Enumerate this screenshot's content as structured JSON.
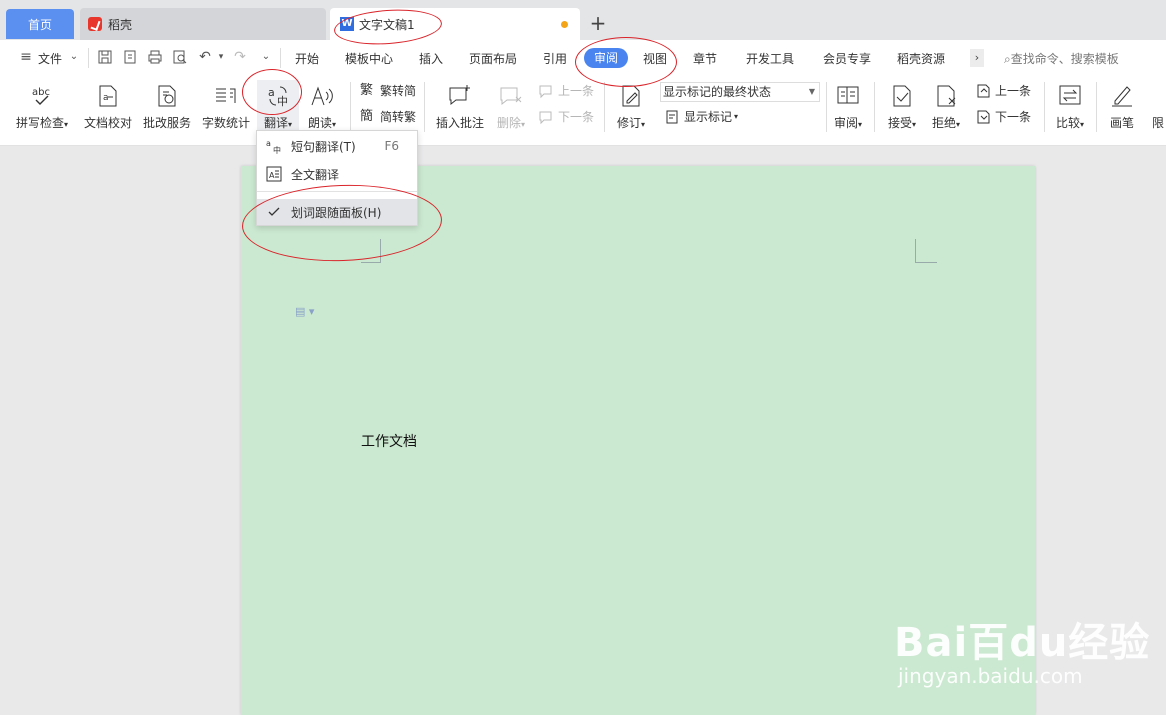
{
  "tabs": {
    "home": "首页",
    "daoke": "稻壳",
    "doc": "文字文稿1",
    "new_tab": "+"
  },
  "menu_bar": {
    "file": "文件",
    "items": [
      "开始",
      "模板中心",
      "插入",
      "页面布局",
      "引用",
      "审阅",
      "视图",
      "章节",
      "开发工具",
      "会员专享",
      "稻壳资源"
    ],
    "active": "审阅",
    "more": "›",
    "search_placeholder": "查找命令、搜索模板"
  },
  "ribbon": {
    "spellcheck": "拼写检查",
    "doc_proof": "文档校对",
    "revise_service": "批改服务",
    "word_count": "字数统计",
    "translate": "翻译",
    "read_aloud": "朗读",
    "trad_to_simp": "繁转简",
    "simp_to_trad": "简转繁",
    "insert_comment": "插入批注",
    "delete": "删除",
    "prev": "上一条",
    "next": "下一条",
    "track_changes": "修订",
    "markup_state": "显示标记的最终状态",
    "show_markup": "显示标记",
    "review": "审阅",
    "accept": "接受",
    "reject": "拒绝",
    "prev_change": "上一条",
    "next_change": "下一条",
    "compare": "比较",
    "pen": "画笔",
    "restrict": "限"
  },
  "translate_menu": {
    "sentence": "短句翻译(T)",
    "sentence_key": "F6",
    "full": "全文翻译",
    "follow_panel": "划词跟随面板(H)"
  },
  "document": {
    "text": "工作文档"
  },
  "watermark": {
    "main": "Bai百du经验",
    "sub": "jingyan.baidu.com"
  },
  "colors": {
    "accent": "#4a84ee",
    "page_bg": "#cbe8d0",
    "annotation": "#d9242a"
  }
}
